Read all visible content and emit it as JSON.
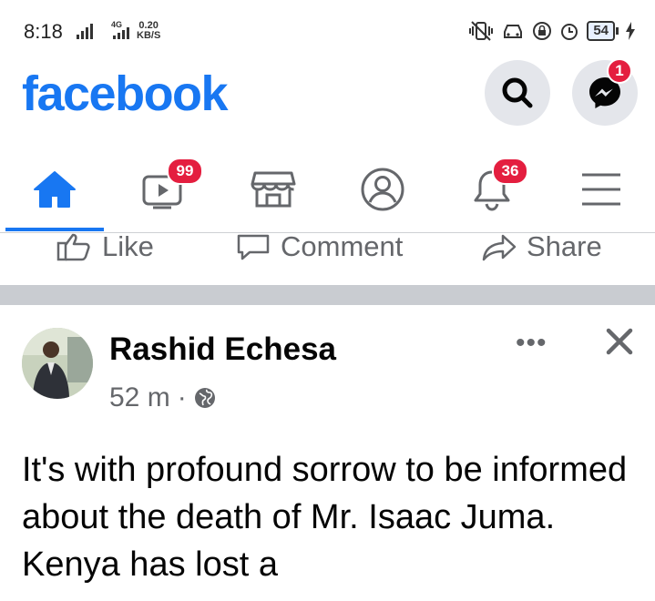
{
  "status_bar": {
    "time": "8:18",
    "network": "4G",
    "speed_value": "0.20",
    "speed_unit": "KB/S",
    "battery": "54"
  },
  "header": {
    "logo": "facebook",
    "messenger_badge": "1"
  },
  "nav": {
    "items": [
      "home",
      "watch",
      "marketplace",
      "profile",
      "notifications",
      "menu"
    ],
    "watch_badge": "99",
    "notifications_badge": "36",
    "active": "home"
  },
  "post_actions": {
    "like": "Like",
    "comment": "Comment",
    "share": "Share"
  },
  "post": {
    "author": "Rashid Echesa",
    "time": "52 m",
    "separator": "·",
    "privacy": "globe-icon",
    "text": "It's with profound sorrow to be informed about the death of Mr. Isaac Juma. Kenya has lost a"
  },
  "colors": {
    "brand": "#1877f2",
    "badge": "#e41e3f",
    "secondary_text": "#65676b",
    "divider": "#c9ccd1"
  }
}
